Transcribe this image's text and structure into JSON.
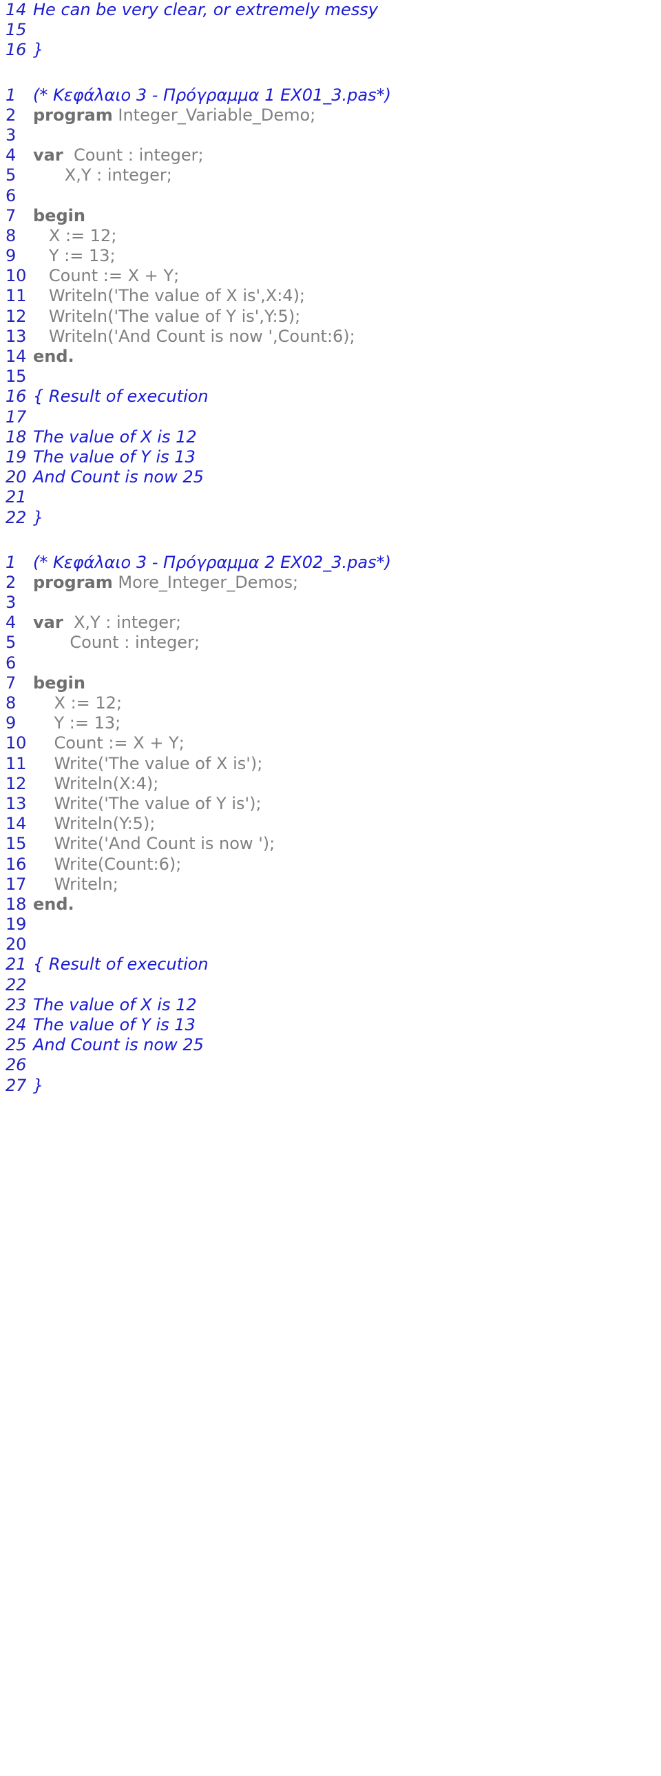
{
  "document": {
    "type": "pascal-code-listing",
    "colors": {
      "line_number": "#2222bb",
      "comment": "#1a1ad6",
      "keyword": "#6f6f6f",
      "code": "#808080",
      "background": "#ffffff"
    }
  },
  "blocks": [
    {
      "id": "block-0",
      "name": "tail-of-previous-listing",
      "lines": [
        {
          "num": "14",
          "style": "comment",
          "text": "He can be very clear, or extremely messy"
        },
        {
          "num": "15",
          "style": "comment",
          "text": ""
        },
        {
          "num": "16",
          "style": "comment",
          "text": "}"
        }
      ]
    },
    {
      "id": "block-1",
      "name": "program-ex01-3",
      "lines": [
        {
          "num": "1",
          "style": "comment",
          "text": "(* Κεφάλαιο 3 - Πρόγραμμα 1 EX01_3.pas*)"
        },
        {
          "num": "2",
          "style": "kw-code",
          "keyword": "program",
          "text": " Integer_Variable_Demo;"
        },
        {
          "num": "3",
          "style": "code",
          "text": ""
        },
        {
          "num": "4",
          "style": "kw-code",
          "keyword": "var",
          "text": "  Count : integer;"
        },
        {
          "num": "5",
          "style": "code",
          "text": "      X,Y : integer;"
        },
        {
          "num": "6",
          "style": "code",
          "text": ""
        },
        {
          "num": "7",
          "style": "kw-code",
          "keyword": "begin",
          "text": ""
        },
        {
          "num": "8",
          "style": "code",
          "text": "   X := 12;"
        },
        {
          "num": "9",
          "style": "code",
          "text": "   Y := 13;"
        },
        {
          "num": "10",
          "style": "code",
          "text": "   Count := X + Y;"
        },
        {
          "num": "11",
          "style": "code",
          "text": "   Writeln('The value of X is',X:4);"
        },
        {
          "num": "12",
          "style": "code",
          "text": "   Writeln('The value of Y is',Y:5);"
        },
        {
          "num": "13",
          "style": "code",
          "text": "   Writeln('And Count is now ',Count:6);"
        },
        {
          "num": "14",
          "style": "kw-code",
          "keyword": "end.",
          "text": ""
        },
        {
          "num": "15",
          "style": "code",
          "text": ""
        },
        {
          "num": "16",
          "style": "comment",
          "text": "{ Result of execution"
        },
        {
          "num": "17",
          "style": "comment",
          "text": ""
        },
        {
          "num": "18",
          "style": "comment",
          "text": "The value of X is 12"
        },
        {
          "num": "19",
          "style": "comment",
          "text": "The value of Y is 13"
        },
        {
          "num": "20",
          "style": "comment",
          "text": "And Count is now 25"
        },
        {
          "num": "21",
          "style": "comment",
          "text": ""
        },
        {
          "num": "22",
          "style": "comment",
          "text": "}"
        }
      ]
    },
    {
      "id": "block-2",
      "name": "program-ex02-3",
      "lines": [
        {
          "num": "1",
          "style": "comment",
          "text": "(* Κεφάλαιο 3 - Πρόγραμμα 2 EX02_3.pas*)"
        },
        {
          "num": "2",
          "style": "kw-code",
          "keyword": "program",
          "text": " More_Integer_Demos;"
        },
        {
          "num": "3",
          "style": "code",
          "text": ""
        },
        {
          "num": "4",
          "style": "kw-code",
          "keyword": "var",
          "text": "  X,Y : integer;"
        },
        {
          "num": "5",
          "style": "code",
          "text": "       Count : integer;"
        },
        {
          "num": "6",
          "style": "code",
          "text": ""
        },
        {
          "num": "7",
          "style": "kw-code",
          "keyword": "begin",
          "text": ""
        },
        {
          "num": "8",
          "style": "code",
          "text": "    X := 12;"
        },
        {
          "num": "9",
          "style": "code",
          "text": "    Y := 13;"
        },
        {
          "num": "10",
          "style": "code",
          "text": "    Count := X + Y;"
        },
        {
          "num": "11",
          "style": "code",
          "text": "    Write('The value of X is');"
        },
        {
          "num": "12",
          "style": "code",
          "text": "    Writeln(X:4);"
        },
        {
          "num": "13",
          "style": "code",
          "text": "    Write('The value of Y is');"
        },
        {
          "num": "14",
          "style": "code",
          "text": "    Writeln(Y:5);"
        },
        {
          "num": "15",
          "style": "code",
          "text": "    Write('And Count is now ');"
        },
        {
          "num": "16",
          "style": "code",
          "text": "    Write(Count:6);"
        },
        {
          "num": "17",
          "style": "code",
          "text": "    Writeln;"
        },
        {
          "num": "18",
          "style": "kw-code",
          "keyword": "end.",
          "text": ""
        },
        {
          "num": "19",
          "style": "code",
          "text": ""
        },
        {
          "num": "20",
          "style": "code",
          "text": ""
        },
        {
          "num": "21",
          "style": "comment",
          "text": "{ Result of execution"
        },
        {
          "num": "22",
          "style": "comment",
          "text": ""
        },
        {
          "num": "23",
          "style": "comment",
          "text": "The value of X is 12"
        },
        {
          "num": "24",
          "style": "comment",
          "text": "The value of Y is 13"
        },
        {
          "num": "25",
          "style": "comment",
          "text": "And Count is now 25"
        },
        {
          "num": "26",
          "style": "comment",
          "text": ""
        },
        {
          "num": "27",
          "style": "comment",
          "text": "}"
        }
      ]
    }
  ]
}
